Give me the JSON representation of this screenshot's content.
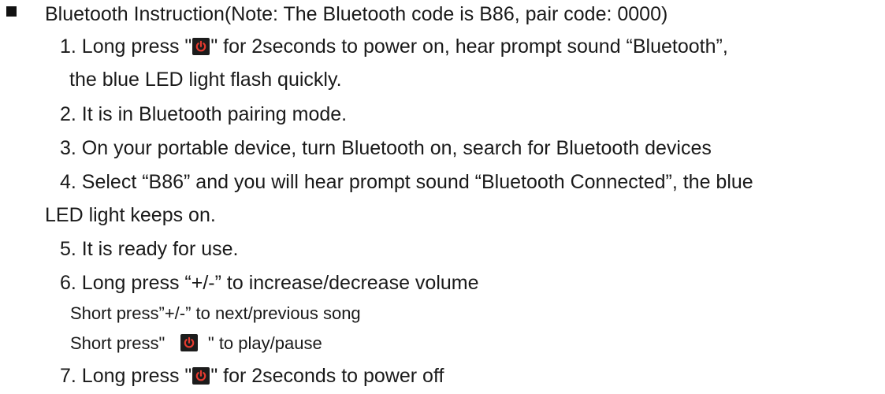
{
  "heading": "Bluetooth Instruction(Note: The Bluetooth code is B86, pair code: 0000)",
  "steps": {
    "s1_a": "1. Long press \"",
    "s1_b": "\" for 2seconds to power on, hear prompt sound “Bluetooth”,",
    "s1_c": "the blue LED light flash quickly.",
    "s2": "2. It is in Bluetooth pairing mode.",
    "s3": "3. On your portable device, turn Bluetooth on, search for Bluetooth devices",
    "s4_a": "4. Select “B86” and you will hear prompt sound “Bluetooth Connected”, the blue",
    "s4_b": "LED light keeps on.",
    "s5": "5. It is ready for use.",
    "s6_a": "6. Long press “+/-” to increase/decrease volume",
    "s6_b": "Short press”+/-” to next/previous song",
    "s6_c1": "Short press\"",
    "s6_c2": "\" to play/pause",
    "s7_a": "7. Long press \"",
    "s7_b": "\" for 2seconds to power off"
  },
  "icons": {
    "power": "power-icon",
    "accent": "#e53a2f"
  }
}
